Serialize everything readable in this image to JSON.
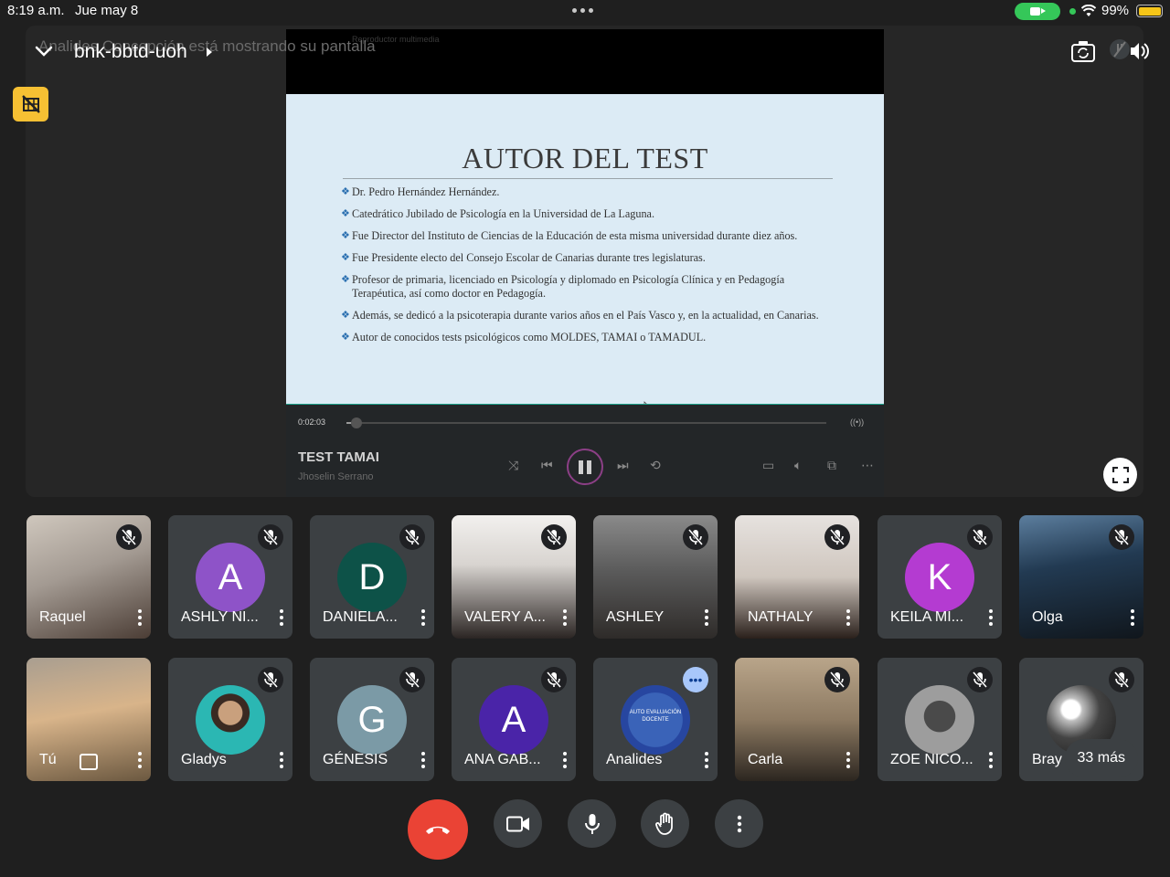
{
  "status_bar": {
    "time": "8:19 a.m.",
    "date": "Jue may 8",
    "battery": "99%"
  },
  "header": {
    "presenting_text": "Analides Concepción está mostrando su pantalla",
    "meeting_code": "bnk-bbtd-uoh"
  },
  "media_player": {
    "window_title": "Reproductor multimedia",
    "elapsed": "0:02:03",
    "progress_fraction": 0.02,
    "track_title": "TEST TAMAI",
    "artist": "Jhoselin Serrano"
  },
  "slide": {
    "title": "AUTOR DEL TEST",
    "bullets": [
      "Dr. Pedro Hernández Hernández.",
      "Catedrático Jubilado de Psicología en la Universidad de La Laguna.",
      "Fue Director del Instituto de Ciencias de la Educación de esta misma universidad durante diez años.",
      "Fue Presidente electo del Consejo Escolar de Canarias durante tres legislaturas.",
      "Profesor de primaria, licenciado en Psicología y diplomado en Psicología Clínica y en Pedagogía Terapéutica, así como doctor en Pedagogía.",
      "Además, se dedicó a la psicoterapia durante varios años en el País Vasco y, en la actualidad, en Canarias.",
      "Autor de conocidos tests psicológicos como MOLDES, TAMAI o TAMADUL."
    ]
  },
  "participants": [
    {
      "name": "Raquel",
      "kind": "video"
    },
    {
      "name": "ASHLY NI...",
      "kind": "letter",
      "letter": "A",
      "color": "#8e53c8"
    },
    {
      "name": "DANIELA...",
      "kind": "letter",
      "letter": "D",
      "color": "#0d5248"
    },
    {
      "name": "VALERY A...",
      "kind": "video"
    },
    {
      "name": "ASHLEY",
      "kind": "video"
    },
    {
      "name": "NATHALY",
      "kind": "video"
    },
    {
      "name": "KEILA MI...",
      "kind": "letter",
      "letter": "K",
      "color": "#b43bd1"
    },
    {
      "name": "Olga",
      "kind": "video"
    },
    {
      "name": "Tú",
      "kind": "self"
    },
    {
      "name": "Gladys",
      "kind": "photo"
    },
    {
      "name": "GÉNESIS",
      "kind": "letter",
      "letter": "G",
      "color": "#7b9aa6"
    },
    {
      "name": "ANA GAB...",
      "kind": "letter",
      "letter": "A",
      "color": "#4a24a8"
    },
    {
      "name": "Analides",
      "kind": "logo"
    },
    {
      "name": "Carla",
      "kind": "video"
    },
    {
      "name": "ZOE NICO...",
      "kind": "photo"
    },
    {
      "name": "Bray",
      "kind": "photo"
    }
  ],
  "overflow_label": "33 más",
  "logo_text": "AUTO EVALUACIÓN DOCENTE",
  "colors": {
    "hangup": "#ea4335",
    "pin_badge": "#f6c033",
    "tile_bg": "#3c4043"
  }
}
